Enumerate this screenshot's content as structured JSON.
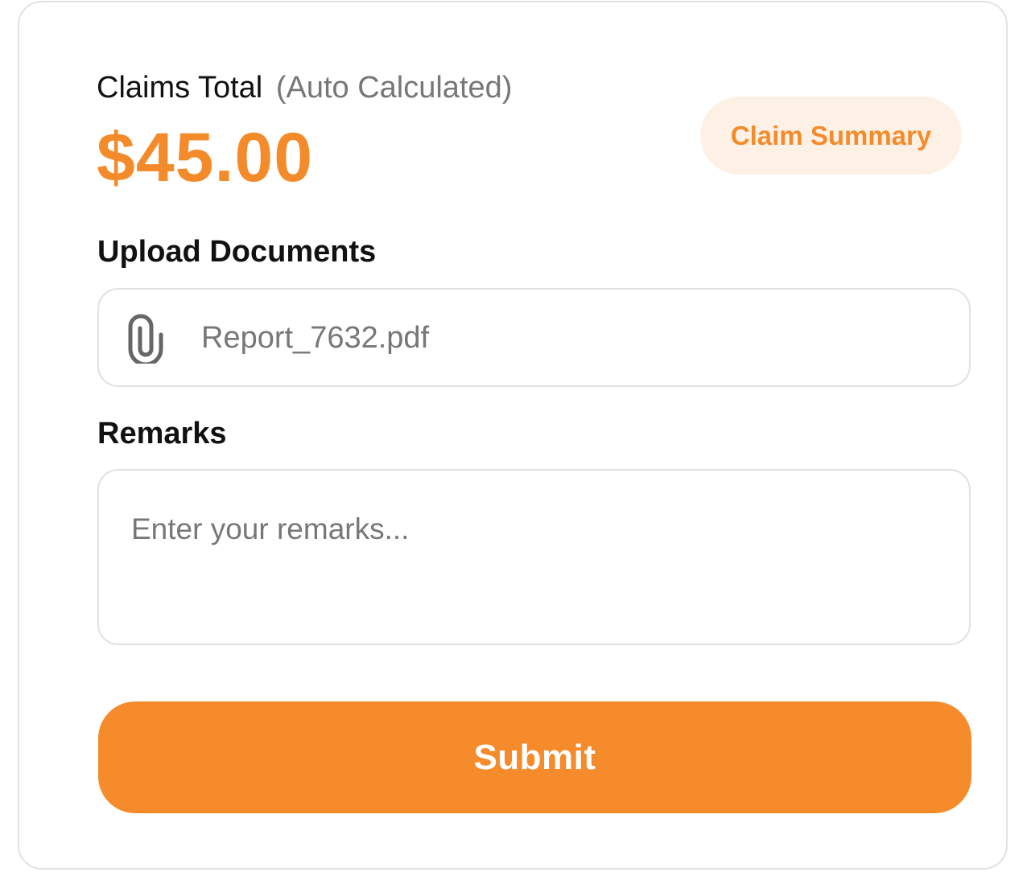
{
  "claims_total": {
    "label": "Claims Total",
    "note": "(Auto Calculated)",
    "amount": "$45.00"
  },
  "summary_button": {
    "label": "Claim Summary"
  },
  "upload": {
    "label": "Upload Documents",
    "file_name": "Report_7632.pdf",
    "icon": "paperclip-icon"
  },
  "remarks": {
    "label": "Remarks",
    "placeholder": "Enter your remarks...",
    "value": ""
  },
  "submit": {
    "label": "Submit"
  },
  "colors": {
    "accent": "#f58b2b",
    "accent_light": "#fdf1e6",
    "text_primary": "#111111",
    "text_muted": "#777777",
    "border": "#e1e1e1"
  }
}
